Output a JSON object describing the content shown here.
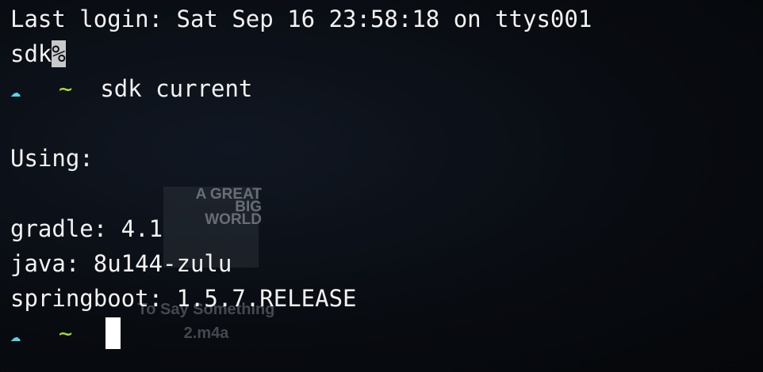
{
  "terminal": {
    "last_login": "Last login: Sat Sep 16 23:58:18 on ttys001",
    "prompt_user": "sdk",
    "prompt_percent": "%",
    "prompt_icon": "☁",
    "prompt_tilde": "~",
    "command": "sdk current",
    "using_label": "Using:",
    "candidates": [
      "gradle: 4.1",
      "java: 8u144-zulu",
      "springboot: 1.5.7.RELEASE"
    ]
  },
  "wallpaper": {
    "album_text": "A GREAT BIG WORLD",
    "track_line1": "To Say Something",
    "track_line2": "2.m4a"
  },
  "colors": {
    "prompt_icon": "#55d6e8",
    "prompt_tilde": "#a6e22e",
    "text": "#f2f2f2",
    "background": "#0a0e14"
  }
}
